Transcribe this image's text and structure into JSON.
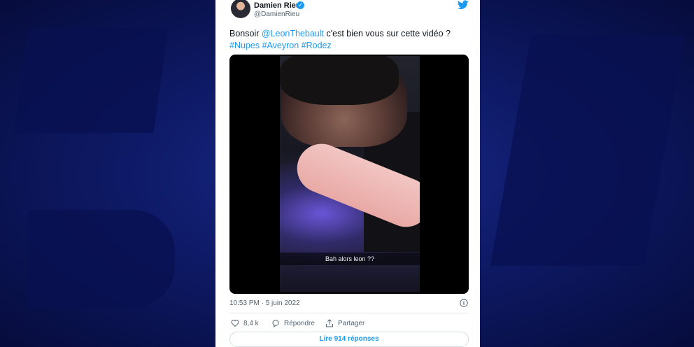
{
  "tweet": {
    "author_name": "Damien Rieu",
    "author_handle": "@DamienRieu",
    "text_parts": {
      "greeting": "Bonsoir ",
      "mention": "@LeonThebault",
      "body": " c'est bien vous sur cette vidéo ?",
      "hashtag1": "#Nupes",
      "hashtag2": "#Aveyron",
      "hashtag3": "#Rodez"
    },
    "video_caption": "Bah alors leon ??",
    "timestamp": "10:53 PM · 5 juin 2022",
    "likes_count": "8,4 k",
    "reply_label": "Répondre",
    "share_label": "Partager",
    "read_replies_label": "Lire 914 réponses"
  },
  "colors": {
    "background": "#0b1450",
    "link_blue": "#1d9bf0",
    "text_primary": "#0f1419",
    "text_secondary": "#536471"
  },
  "icons": [
    "verified-badge-icon",
    "twitter-bird-icon",
    "info-icon",
    "heart-icon",
    "reply-bubble-icon",
    "share-icon"
  ]
}
